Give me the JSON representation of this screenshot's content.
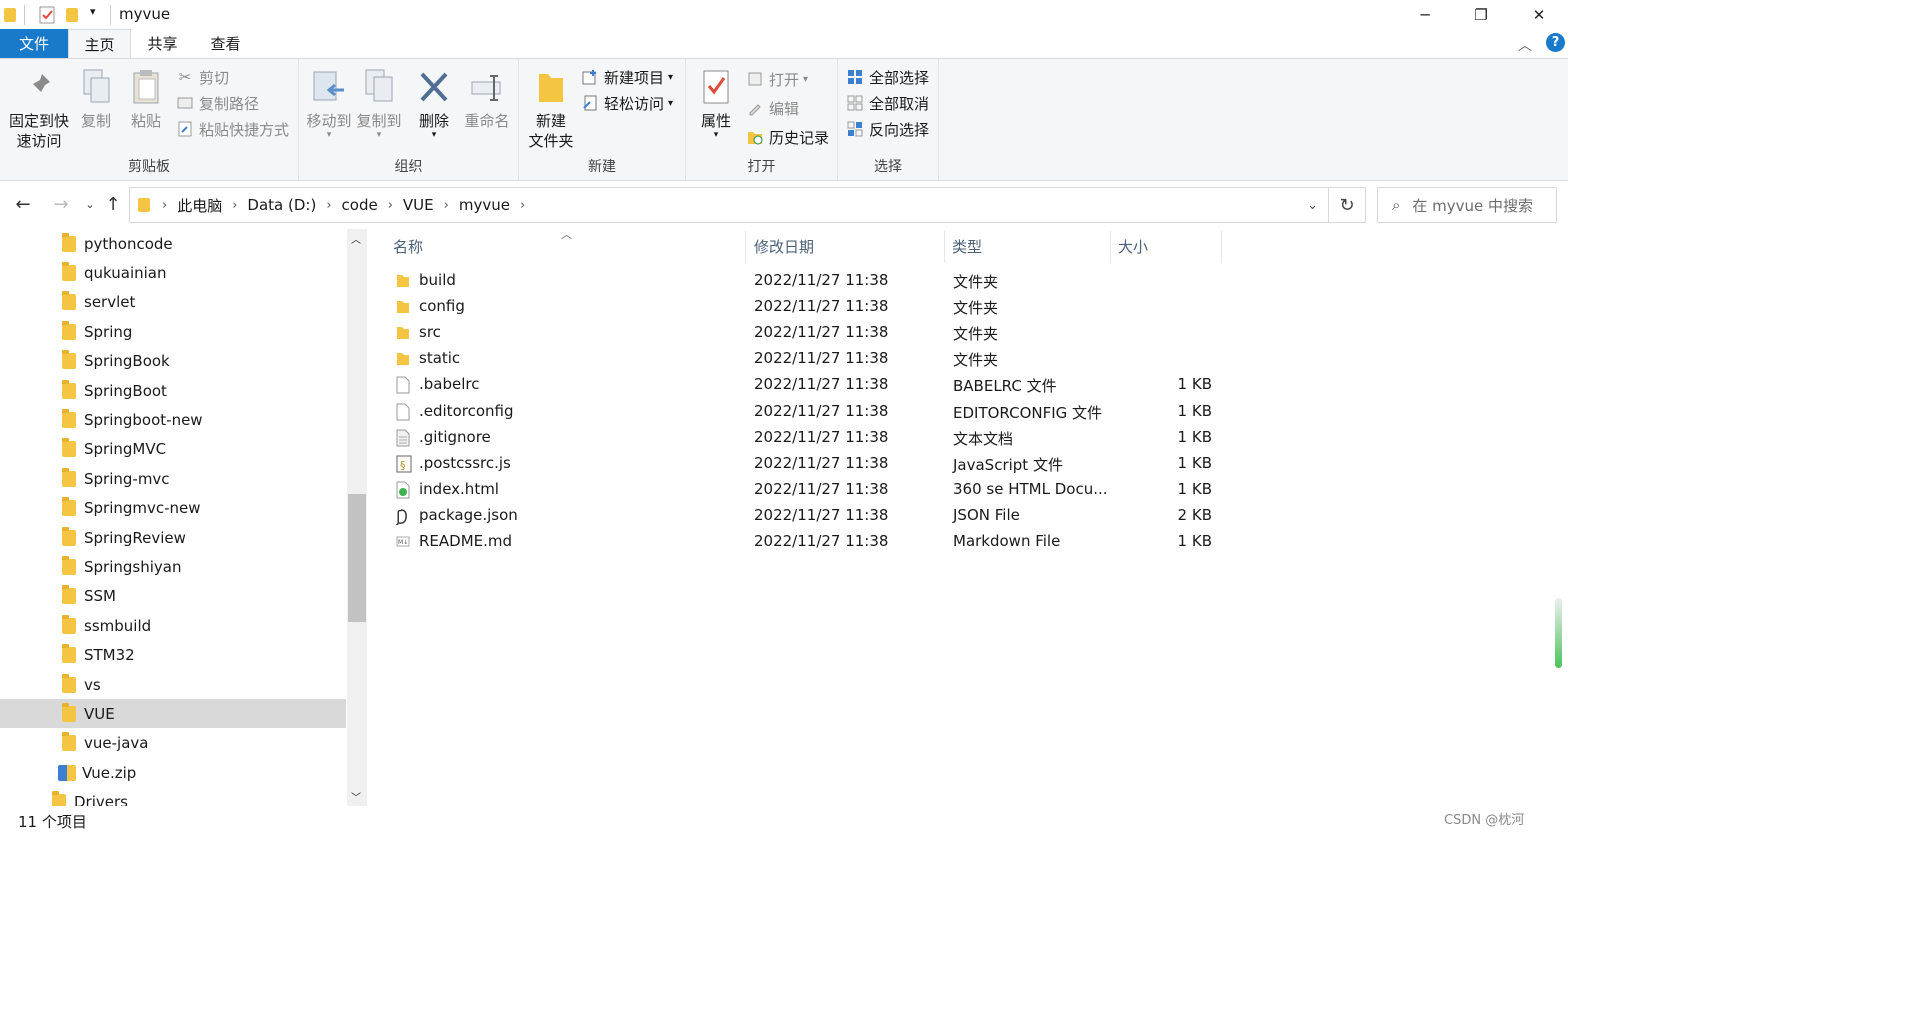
{
  "window": {
    "title": "myvue",
    "min_glyph": "─",
    "max_glyph": "❐",
    "close_glyph": "✕"
  },
  "tabs": {
    "file": "文件",
    "home": "主页",
    "share": "共享",
    "view": "查看"
  },
  "ribbon": {
    "clipboard": {
      "title": "剪贴板",
      "pin_line1": "固定到快",
      "pin_line2": "速访问",
      "copy": "复制",
      "paste": "粘贴",
      "cut": "剪切",
      "copy_path": "复制路径",
      "paste_shortcut": "粘贴快捷方式"
    },
    "organize": {
      "title": "组织",
      "move_to": "移动到",
      "copy_to": "复制到",
      "delete": "删除",
      "rename": "重命名"
    },
    "new": {
      "title": "新建",
      "new_folder_line1": "新建",
      "new_folder_line2": "文件夹",
      "new_item": "新建项目",
      "easy_access": "轻松访问"
    },
    "open": {
      "title": "打开",
      "properties": "属性",
      "open": "打开",
      "edit": "编辑",
      "history": "历史记录"
    },
    "select": {
      "title": "选择",
      "select_all": "全部选择",
      "select_none": "全部取消",
      "invert": "反向选择"
    }
  },
  "address": {
    "crumbs": [
      "此电脑",
      "Data (D:)",
      "code",
      "VUE",
      "myvue"
    ],
    "search_placeholder": "在 myvue 中搜索"
  },
  "nav_items": [
    "pythoncode",
    "qukuainian",
    "servlet",
    "Spring",
    "SpringBook",
    "SpringBoot",
    "Springboot-new",
    "SpringMVC",
    "Spring-mvc",
    "Springmvc-new",
    "SpringReview",
    "Springshiyan",
    "SSM",
    "ssmbuild",
    "STM32",
    "vs",
    "VUE",
    "vue-java",
    "Vue.zip",
    "Drivers"
  ],
  "columns": {
    "name": "名称",
    "date": "修改日期",
    "type": "类型",
    "size": "大小"
  },
  "files": [
    {
      "name": "build",
      "date": "2022/11/27 11:38",
      "type": "文件夹",
      "size": "",
      "icon": "folder-icon"
    },
    {
      "name": "config",
      "date": "2022/11/27 11:38",
      "type": "文件夹",
      "size": "",
      "icon": "folder-icon"
    },
    {
      "name": "src",
      "date": "2022/11/27 11:38",
      "type": "文件夹",
      "size": "",
      "icon": "folder-icon"
    },
    {
      "name": "static",
      "date": "2022/11/27 11:38",
      "type": "文件夹",
      "size": "",
      "icon": "folder-icon"
    },
    {
      "name": ".babelrc",
      "date": "2022/11/27 11:38",
      "type": "BABELRC 文件",
      "size": "1 KB",
      "icon": "file-icon"
    },
    {
      "name": ".editorconfig",
      "date": "2022/11/27 11:38",
      "type": "EDITORCONFIG 文件",
      "size": "1 KB",
      "icon": "file-icon"
    },
    {
      "name": ".gitignore",
      "date": "2022/11/27 11:38",
      "type": "文本文档",
      "size": "1 KB",
      "icon": "text-file-icon"
    },
    {
      "name": ".postcssrc.js",
      "date": "2022/11/27 11:38",
      "type": "JavaScript 文件",
      "size": "1 KB",
      "icon": "js-file-icon"
    },
    {
      "name": "index.html",
      "date": "2022/11/27 11:38",
      "type": "360 se HTML Docu...",
      "size": "1 KB",
      "icon": "html-file-icon"
    },
    {
      "name": "package.json",
      "date": "2022/11/27 11:38",
      "type": "JSON File",
      "size": "2 KB",
      "icon": "json-file-icon"
    },
    {
      "name": "README.md",
      "date": "2022/11/27 11:38",
      "type": "Markdown File",
      "size": "1 KB",
      "icon": "markdown-file-icon"
    }
  ],
  "status": {
    "count": "11 个项目"
  },
  "watermark": "CSDN @枕河"
}
